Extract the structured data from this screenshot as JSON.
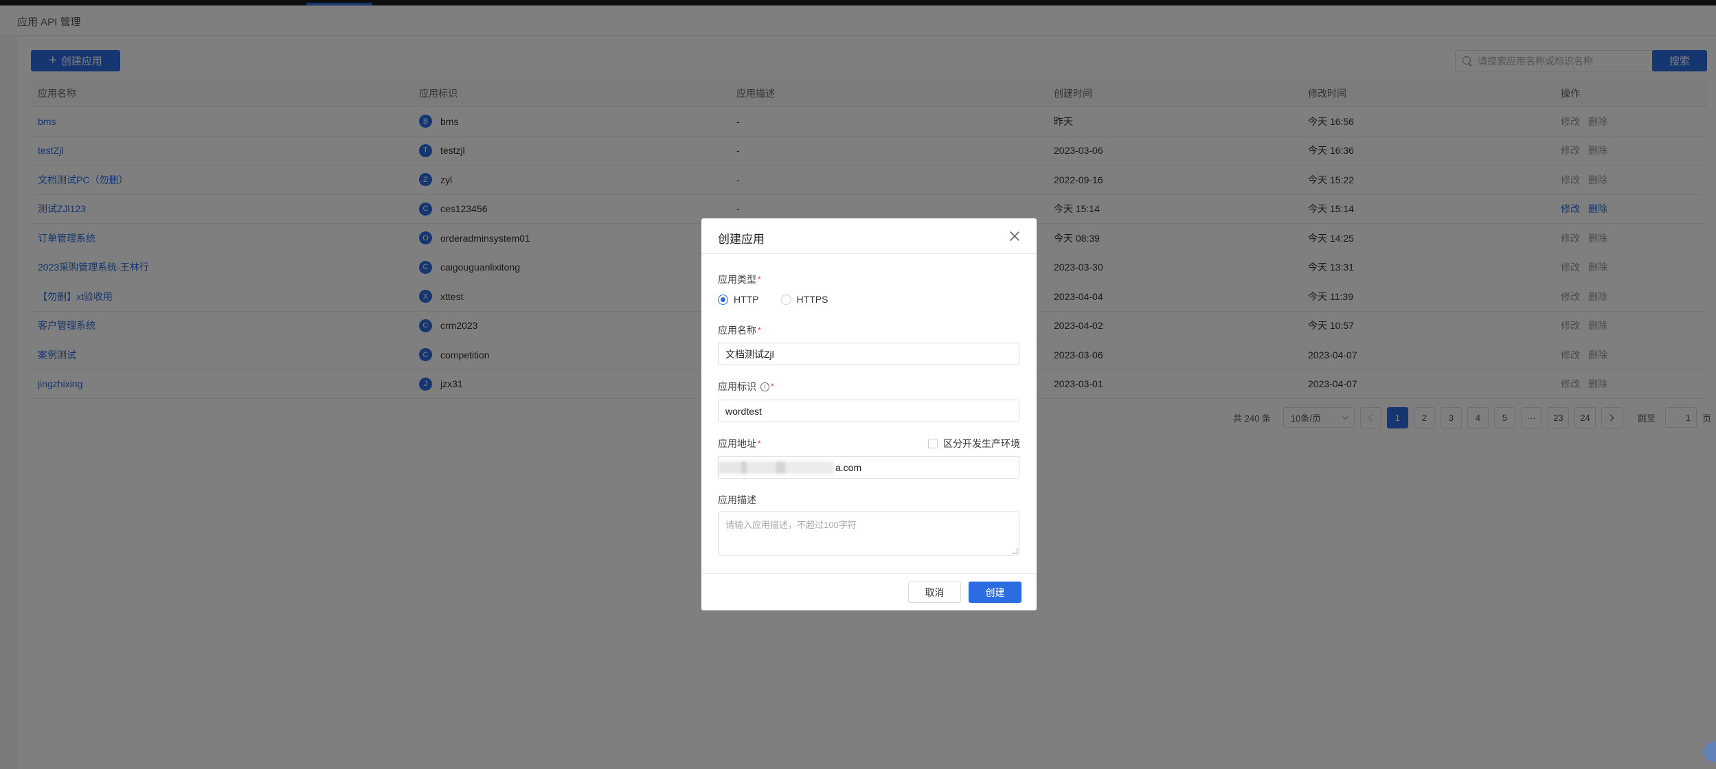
{
  "page_title": "应用 API 管理",
  "toolbar": {
    "create_label": "创建应用",
    "search_placeholder": "请搜索应用名称或标识名称",
    "search_label": "搜索"
  },
  "table": {
    "headers": [
      "应用名称",
      "应用标识",
      "应用描述",
      "创建时间",
      "修改时间",
      "操作"
    ],
    "rows": [
      {
        "name": "bms",
        "avatar": "B",
        "id": "bms",
        "desc": "-",
        "created": "昨天",
        "modified": "今天 16:56"
      },
      {
        "name": "testZjl",
        "avatar": "T",
        "id": "testzjl",
        "desc": "-",
        "created": "2023-03-06",
        "modified": "今天 16:36"
      },
      {
        "name": "文档测试PC（勿删）",
        "avatar": "Z",
        "id": "zyl",
        "desc": "-",
        "created": "2022-09-16",
        "modified": "今天 15:22"
      },
      {
        "name": "测试ZJl123",
        "avatar": "C",
        "id": "ces123456",
        "desc": "-",
        "created": "今天 15:14",
        "modified": "今天 15:14"
      },
      {
        "name": "订单管理系统",
        "avatar": "O",
        "id": "orderadminsystem01",
        "desc": "",
        "created": "今天 08:39",
        "modified": "今天 14:25"
      },
      {
        "name": "2023采购管理系统-王林行",
        "avatar": "C",
        "id": "caigouguanlixitong",
        "desc": "",
        "created": "2023-03-30",
        "modified": "今天 13:31"
      },
      {
        "name": "【勿删】xt验收用",
        "avatar": "X",
        "id": "xttest",
        "desc": "",
        "created": "2023-04-04",
        "modified": "今天 11:39"
      },
      {
        "name": "客户管理系统",
        "avatar": "C",
        "id": "crm2023",
        "desc": "",
        "created": "2023-04-02",
        "modified": "今天 10:57"
      },
      {
        "name": "案例测试",
        "avatar": "C",
        "id": "competition",
        "desc": "",
        "created": "2023-03-06",
        "modified": "2023-04-07"
      },
      {
        "name": "jingzhixing",
        "avatar": "J",
        "id": "jzx31",
        "desc": "",
        "created": "2023-03-01",
        "modified": "2023-04-07"
      }
    ],
    "op_edit": "修改",
    "op_delete": "删除"
  },
  "pagination": {
    "total": "共 240 条",
    "page_size": "10条/页",
    "pages": [
      "1",
      "2",
      "3",
      "4",
      "5",
      "···",
      "23",
      "24"
    ],
    "current": "1",
    "jump_label": "跳至",
    "jump_value": "1",
    "page_suffix": "页"
  },
  "modal": {
    "title": "创建应用",
    "type_label": "应用类型",
    "type_options": [
      "HTTP",
      "HTTPS"
    ],
    "type_selected": "HTTP",
    "name_label": "应用名称",
    "name_value": "文档测试Zjl",
    "id_label": "应用标识",
    "id_value": "wordtest",
    "addr_label": "应用地址",
    "addr_value": "a.com",
    "env_checkbox_label": "区分开发生产环境",
    "desc_label": "应用描述",
    "desc_placeholder": "请输入应用描述，不超过100字符",
    "cancel_label": "取消",
    "confirm_label": "创建"
  },
  "colors": {
    "primary": "#2b6de0",
    "required": "#e04040",
    "mask": "rgba(0,0,0,0.5)"
  }
}
